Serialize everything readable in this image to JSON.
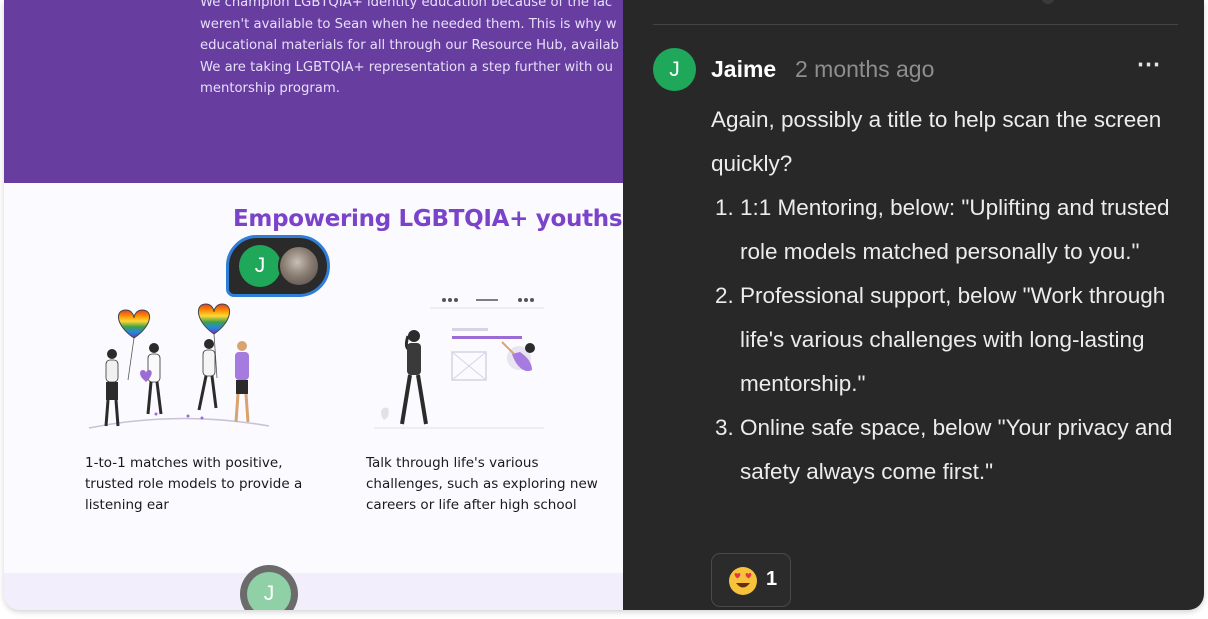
{
  "website": {
    "intro_lines": [
      "We champion LGBTQIA+ identity education because of the lac",
      "weren't available to Sean when he needed them. This is why w",
      "educational materials for all through our Resource Hub, availab",
      "We are taking LGBTQIA+ representation a step further with ou",
      "mentorship program."
    ],
    "section_title": "Empowering LGBTQIA+ youths",
    "cards": [
      {
        "text_lines": [
          "1-to-1 matches with positive,",
          "trusted role models to provide a",
          "listening ear"
        ]
      },
      {
        "text_lines": [
          "Talk through life's various",
          "challenges, such as exploring new",
          "careers or life after high school"
        ]
      }
    ],
    "presence_avatar_initial": "J",
    "floating_avatar_initial": "J"
  },
  "comment": {
    "avatar_initial": "J",
    "author": "Jaime",
    "time": "2 months ago",
    "more_label": "⋯",
    "intro": "Again, possibly a title to help scan the screen quickly?",
    "items": [
      "1:1 Mentoring, below: \"Uplifting and trusted role models matched personally to you.\"",
      "Professional support, below \"Work through life's various challenges with long-lasting mentorship.\"",
      "Online safe space, below \"Your privacy and safety always come first.\""
    ],
    "reaction": {
      "icon": "heart-eyes-emoji-icon",
      "count": "1"
    }
  },
  "colors": {
    "accent_purple": "#673ea0",
    "title_purple": "#7b43c9",
    "avatar_green": "#1fa85a",
    "panel_bg": "#282828",
    "selection_blue": "#2f7fd6"
  }
}
